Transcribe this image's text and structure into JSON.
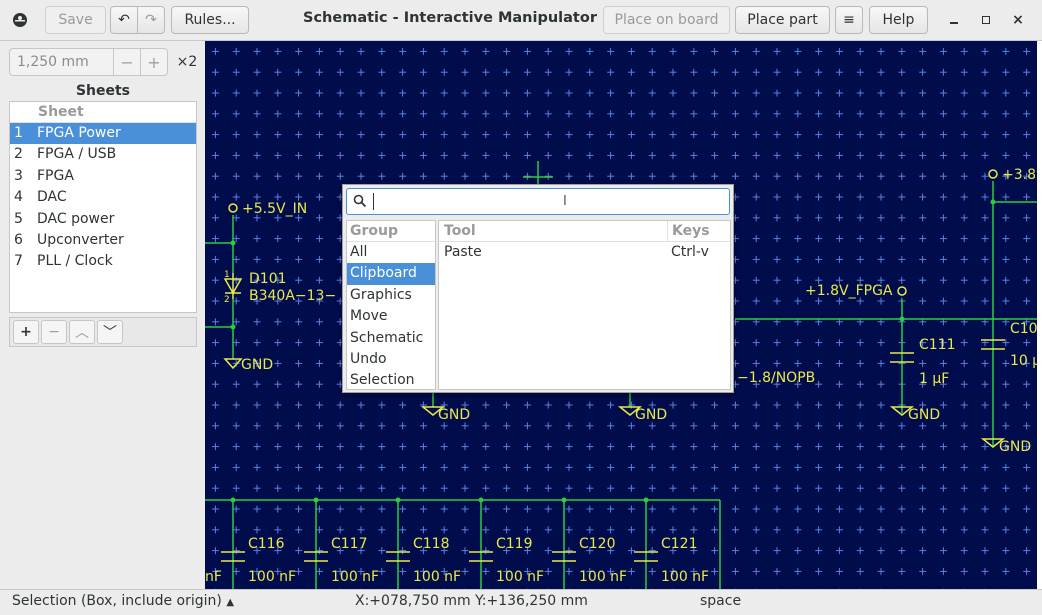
{
  "window": {
    "title": "Schematic - Interactive Manipulator",
    "save_label": "Save",
    "rules_label": "Rules...",
    "place_on_board_label": "Place on board",
    "place_part_label": "Place part",
    "help_label": "Help"
  },
  "grid": {
    "spacing_value": "1,250 mm",
    "multiplier": "×2"
  },
  "sheets": {
    "title": "Sheets",
    "column_header": "Sheet",
    "items": [
      {
        "num": "1",
        "name": "FPGA Power"
      },
      {
        "num": "2",
        "name": "FPGA / USB"
      },
      {
        "num": "3",
        "name": "FPGA"
      },
      {
        "num": "4",
        "name": "DAC"
      },
      {
        "num": "5",
        "name": "DAC power"
      },
      {
        "num": "6",
        "name": "Upconverter"
      },
      {
        "num": "7",
        "name": "PLL / Clock"
      }
    ],
    "selected_index": 0
  },
  "schematic": {
    "labels": {
      "vin": "+5.5V_IN",
      "v38": "+3.8",
      "d101_ref": "D101",
      "d101_val": "B340A−13−",
      "gnd": "GND",
      "v18": "+1.8V_FPGA",
      "c111_ref": "C111",
      "c111_val": "1 μF",
      "c10_ref": "C10",
      "c10_val": "10 μ",
      "nopb": "−1.8/NOPB",
      "pin1": "1",
      "pin2": "2",
      "nf_partial": "nF",
      "caps": [
        {
          "ref": "C116",
          "val": "100 nF"
        },
        {
          "ref": "C117",
          "val": "100 nF"
        },
        {
          "ref": "C118",
          "val": "100 nF"
        },
        {
          "ref": "C119",
          "val": "100 nF"
        },
        {
          "ref": "C120",
          "val": "100 nF"
        },
        {
          "ref": "C121",
          "val": "100 nF"
        }
      ]
    }
  },
  "popup": {
    "search_value": "",
    "group_header": "Group",
    "tool_header": "Tool",
    "keys_header": "Keys",
    "groups": [
      "All",
      "Clipboard",
      "Graphics",
      "Move",
      "Schematic",
      "Undo",
      "Selection"
    ],
    "selected_group": "Clipboard",
    "tools": [
      {
        "name": "Paste",
        "keys": "Ctrl-v"
      }
    ]
  },
  "status": {
    "selection_mode": "Selection (Box, include origin)",
    "coordinates": "X:+078,750 mm Y:+136,250 mm",
    "key": "space"
  },
  "colors": {
    "canvas_bg": "#000c4c",
    "wire": "#2ecc40",
    "schematic_text": "#e9e94b",
    "selection_blue": "#4a90d9"
  }
}
